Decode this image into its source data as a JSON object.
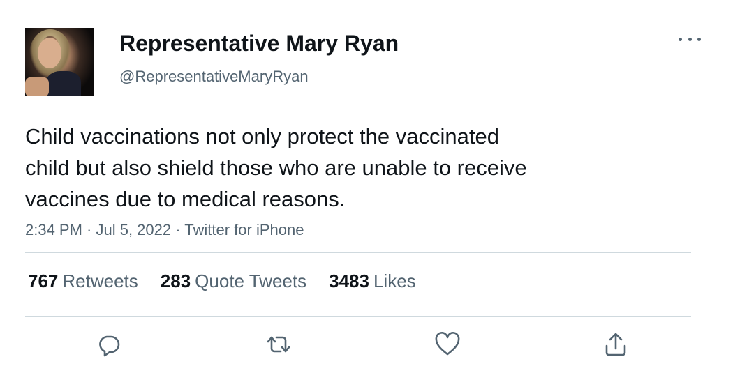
{
  "user": {
    "display_name": "Representative Mary Ryan",
    "handle": "@RepresentativeMaryRyan"
  },
  "tweet": {
    "text": "Child vaccinations not only protect the vaccinated\nchild but also shield those who are unable to receive\nvaccines due to medical reasons.",
    "meta": "2:34 PM · Jul 5, 2022 · Twitter for iPhone"
  },
  "stats": {
    "retweets_count": "767",
    "retweets_label": "Retweets",
    "quotes_count": "283",
    "quotes_label": "Quote Tweets",
    "likes_count": "3483",
    "likes_label": "Likes"
  },
  "icons": {
    "more": "more-options-icon",
    "reply": "reply-icon",
    "retweet": "retweet-icon",
    "like": "like-icon",
    "share": "share-icon"
  },
  "colors": {
    "text": "#0f1419",
    "secondary": "#536471",
    "divider": "#cfd9de"
  }
}
